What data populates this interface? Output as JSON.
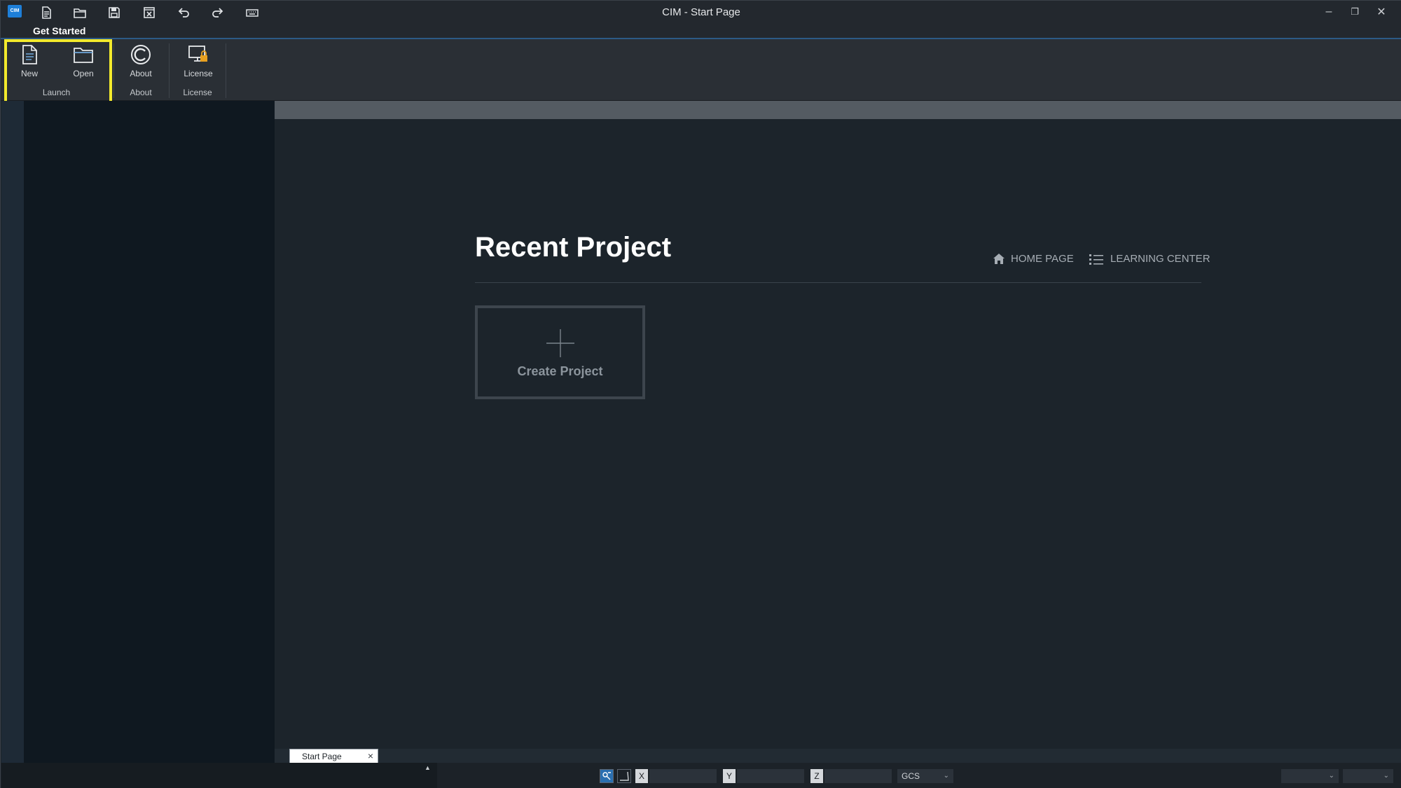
{
  "window": {
    "title": "CIM - Start Page",
    "app_logo": "CIM"
  },
  "quick_access": [
    "app-logo-icon",
    "new-file-icon",
    "open-folder-icon",
    "save-icon",
    "close-file-icon",
    "undo-icon",
    "redo-icon",
    "keyboard-icon"
  ],
  "ribbon": {
    "tab": "Get Started",
    "buttons": {
      "new": "New",
      "open": "Open",
      "about": "About",
      "license": "License"
    },
    "groups": {
      "launch": "Launch",
      "about": "About",
      "license": "License"
    }
  },
  "main": {
    "title": "Recent Project",
    "home_link": "HOME PAGE",
    "learning_link": "LEARNING CENTER",
    "create_project": "Create Project"
  },
  "doc_tab": {
    "label": "Start Page",
    "close": "×"
  },
  "status": {
    "x_label": "X",
    "y_label": "Y",
    "z_label": "Z",
    "x_value": "",
    "y_value": "",
    "z_value": "",
    "coord_system": "GCS",
    "dropdown_arrow": "⌄"
  },
  "colors": {
    "highlight": "#f3ea2c",
    "accent": "#1e7fd8",
    "license_lock": "#e8a020"
  }
}
